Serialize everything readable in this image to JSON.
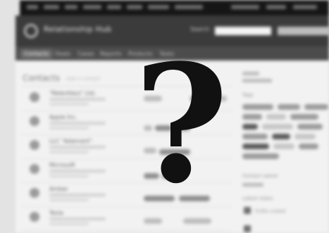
{
  "app": {
    "brand": "Relationship Hub",
    "search_label": "Search"
  },
  "tabs": [
    {
      "label": "Contacts",
      "active": true
    },
    {
      "label": "Deals"
    },
    {
      "label": "Cases"
    },
    {
      "label": "Reports"
    },
    {
      "label": "Products"
    },
    {
      "label": "Tasks"
    }
  ],
  "main": {
    "heading": "Contacts",
    "subheading": "Add a contact"
  },
  "contacts": [
    {
      "name": "\"Relentless\" Ltd."
    },
    {
      "name": "Apple Inc."
    },
    {
      "name": "LLC \"Adamant\""
    },
    {
      "name": "Microsoft"
    },
    {
      "name": "Amber"
    },
    {
      "name": "Tesla"
    }
  ],
  "sidebar": {
    "tags_label": "Tags",
    "section2_label": "Contact owner",
    "section3_label": "Latest notes",
    "note_1": "Profile created"
  },
  "overlay": {
    "glyph": "?"
  }
}
